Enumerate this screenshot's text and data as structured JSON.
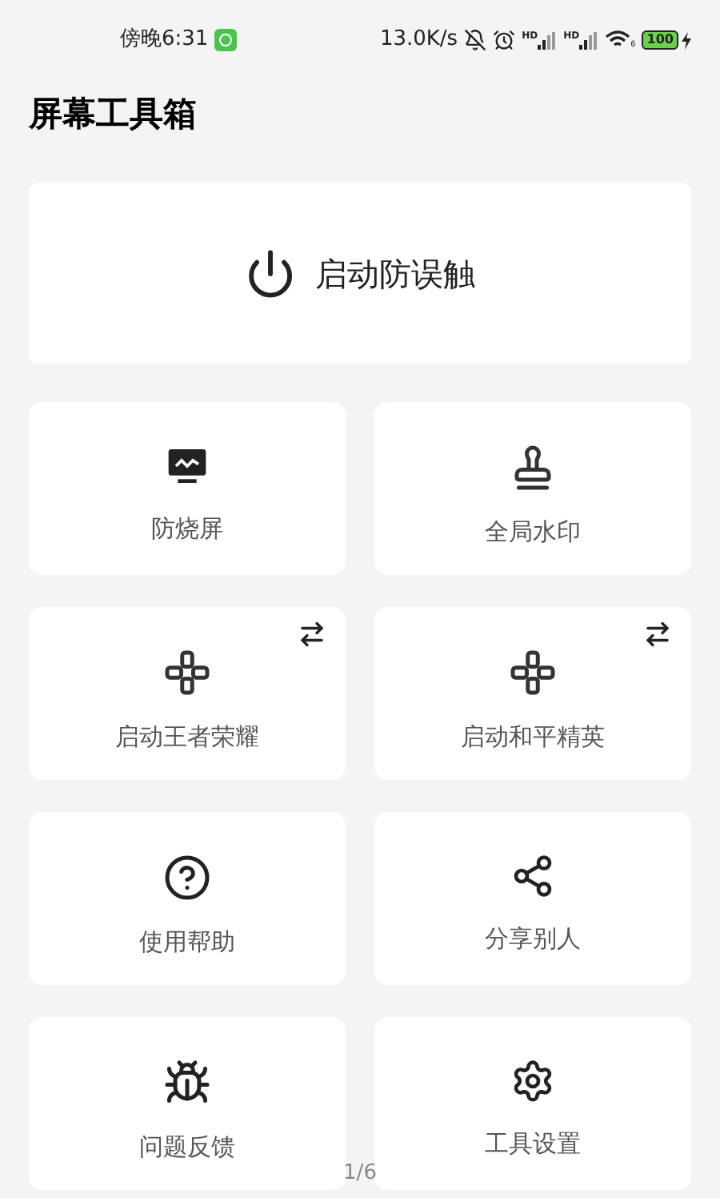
{
  "status_bar": {
    "time": "傍晚6:31",
    "speed": "13.0K/s",
    "signals": [
      "HD",
      "HD"
    ],
    "wifi_label": "6",
    "battery": "100"
  },
  "title": "屏幕工具箱",
  "main_button": {
    "label": "启动防误触"
  },
  "tools": [
    {
      "label": "防烧屏",
      "switchable": false
    },
    {
      "label": "全局水印",
      "switchable": false
    },
    {
      "label": "启动王者荣耀",
      "switchable": true
    },
    {
      "label": "启动和平精英",
      "switchable": true
    },
    {
      "label": "使用帮助",
      "switchable": false
    },
    {
      "label": "分享别人",
      "switchable": false
    },
    {
      "label": "问题反馈",
      "switchable": false
    },
    {
      "label": "工具设置",
      "switchable": false
    }
  ],
  "page_indicator": "1/6"
}
